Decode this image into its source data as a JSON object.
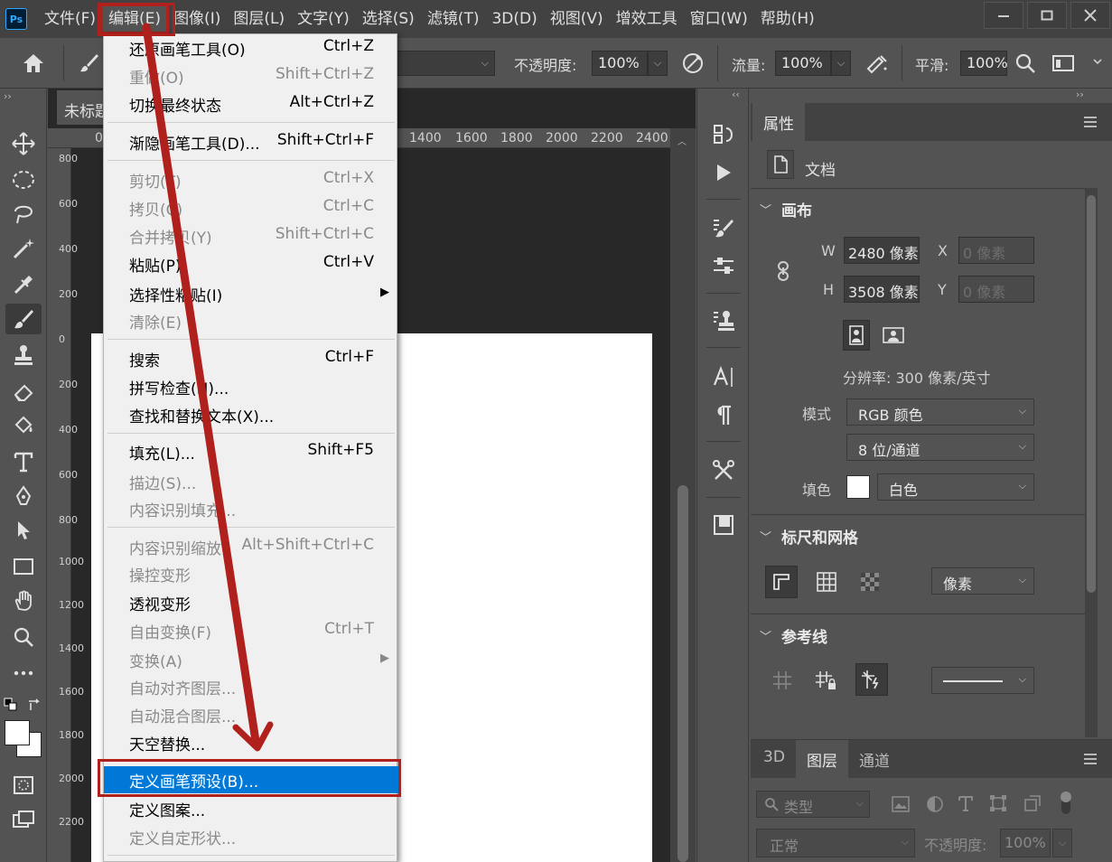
{
  "app": {
    "logo": "Ps"
  },
  "menubar": {
    "items": [
      "文件(F)",
      "编辑(E)",
      "图像(I)",
      "图层(L)",
      "文字(Y)",
      "选择(S)",
      "滤镜(T)",
      "3D(D)",
      "视图(V)",
      "增效工具",
      "窗口(W)",
      "帮助(H)"
    ],
    "active": "编辑(E)"
  },
  "options": {
    "opacity_label": "不透明度:",
    "opacity_value": "100%",
    "flow_label": "流量:",
    "flow_value": "100%",
    "smooth_label": "平滑:",
    "smooth_value": "100%"
  },
  "document": {
    "tab_title": "未标题",
    "ruler_h": [
      "0",
      "1400",
      "1600",
      "1800",
      "2000",
      "2200",
      "2400"
    ],
    "ruler_v": [
      "800",
      "600",
      "400",
      "200",
      "0",
      "200",
      "400",
      "600",
      "800",
      "1000",
      "1200",
      "1400",
      "1600",
      "1800",
      "2000",
      "2200"
    ]
  },
  "edit_menu": {
    "items": [
      {
        "label": "还原画笔工具(O)",
        "shortcut": "Ctrl+Z",
        "disabled": false
      },
      {
        "label": "重做(O)",
        "shortcut": "Shift+Ctrl+Z",
        "disabled": true
      },
      {
        "label": "切换最终状态",
        "shortcut": "Alt+Ctrl+Z",
        "disabled": false
      },
      {
        "label": "渐隐画笔工具(D)...",
        "shortcut": "Shift+Ctrl+F",
        "disabled": false
      },
      {
        "label": "剪切(T)",
        "shortcut": "Ctrl+X",
        "disabled": true
      },
      {
        "label": "拷贝(C)",
        "shortcut": "Ctrl+C",
        "disabled": true
      },
      {
        "label": "合并拷贝(Y)",
        "shortcut": "Shift+Ctrl+C",
        "disabled": true
      },
      {
        "label": "粘贴(P)",
        "shortcut": "Ctrl+V",
        "disabled": false
      },
      {
        "label": "选择性粘贴(I)",
        "shortcut": "",
        "disabled": false,
        "submenu": true
      },
      {
        "label": "清除(E)",
        "shortcut": "",
        "disabled": true
      },
      {
        "label": "搜索",
        "shortcut": "Ctrl+F",
        "disabled": false
      },
      {
        "label": "拼写检查(H)...",
        "shortcut": "",
        "disabled": false
      },
      {
        "label": "查找和替换文本(X)...",
        "shortcut": "",
        "disabled": false
      },
      {
        "label": "填充(L)...",
        "shortcut": "Shift+F5",
        "disabled": false
      },
      {
        "label": "描边(S)...",
        "shortcut": "",
        "disabled": true
      },
      {
        "label": "内容识别填充...",
        "shortcut": "",
        "disabled": true
      },
      {
        "label": "内容识别缩放",
        "shortcut": "Alt+Shift+Ctrl+C",
        "disabled": true
      },
      {
        "label": "操控变形",
        "shortcut": "",
        "disabled": true
      },
      {
        "label": "透视变形",
        "shortcut": "",
        "disabled": false
      },
      {
        "label": "自由变换(F)",
        "shortcut": "Ctrl+T",
        "disabled": true
      },
      {
        "label": "变换(A)",
        "shortcut": "",
        "disabled": true,
        "submenu": true
      },
      {
        "label": "自动对齐图层...",
        "shortcut": "",
        "disabled": true
      },
      {
        "label": "自动混合图层...",
        "shortcut": "",
        "disabled": true
      },
      {
        "label": "天空替换...",
        "shortcut": "",
        "disabled": false
      },
      {
        "label": "定义画笔预设(B)...",
        "shortcut": "",
        "disabled": false,
        "highlighted": true
      },
      {
        "label": "定义图案...",
        "shortcut": "",
        "disabled": false
      },
      {
        "label": "定义自定形状...",
        "shortcut": "",
        "disabled": true
      }
    ]
  },
  "properties": {
    "tab": "属性",
    "doc_label": "文档",
    "canvas": {
      "title": "画布",
      "w_label": "W",
      "w_value": "2480 像素",
      "h_label": "H",
      "h_value": "3508 像素",
      "x_label": "X",
      "x_value": "0 像素",
      "y_label": "Y",
      "y_value": "0 像素",
      "resolution": "分辨率: 300 像素/英寸",
      "mode_label": "模式",
      "mode_value": "RGB 颜色",
      "depth_value": "8 位/通道",
      "fill_label": "填色",
      "fill_value": "白色"
    },
    "rulers": {
      "title": "标尺和网格",
      "unit": "像素"
    },
    "guides": {
      "title": "参考线"
    }
  },
  "layers": {
    "tabs": [
      "3D",
      "图层",
      "通道"
    ],
    "active_tab": "图层",
    "filter_placeholder": "类型",
    "blend_mode": "正常",
    "opacity_label": "不透明度:",
    "opacity_value": "100%"
  },
  "colors": {
    "highlight": "#0078d7",
    "annotation": "#b0201c",
    "panel": "#535353"
  }
}
